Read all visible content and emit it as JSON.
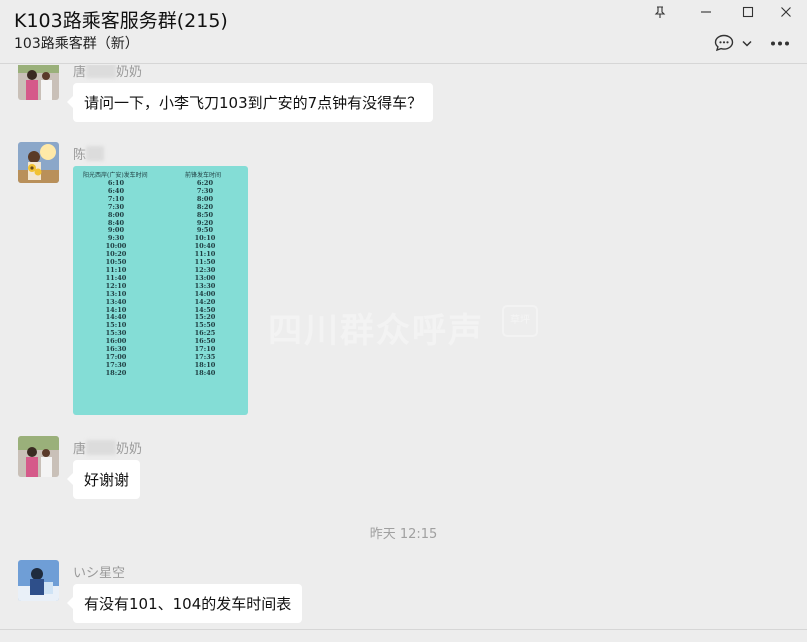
{
  "window": {
    "title": "K103路乘客服务群(215)",
    "subtitle": "103路乘客群（新）"
  },
  "icons": {
    "pin": "pin-icon",
    "minimize": "minimize-icon",
    "maximize": "maximize-icon",
    "close": "close-icon",
    "chat_bubble": "chat-bubble-icon",
    "chevron": "chevron-down-icon",
    "more": "more-icon"
  },
  "messages": [
    {
      "sender_prefix": "唐",
      "sender_suffix": "奶奶",
      "text": "请问一下，小李飞刀103到广安的7点钟有没得车？"
    },
    {
      "sender_prefix": "陈",
      "sender_suffix": "",
      "type": "image"
    },
    {
      "sender_prefix": "唐",
      "sender_suffix": "奶奶",
      "text": "好谢谢"
    },
    {
      "sender_prefix": "いシ星空",
      "sender_suffix": "",
      "text": "有没有101、104的发车时间表"
    }
  ],
  "timestamp": "昨天 12:15",
  "schedule_image": {
    "left_header": "阳光西岸(广安)发车时间",
    "right_header": "前锋发车时间",
    "left_times": [
      "6:10",
      "6:40",
      "7:10",
      "7:30",
      "8:00",
      "8:40",
      "9:00",
      "9:30",
      "10:00",
      "10:20",
      "10:50",
      "11:10",
      "11:40",
      "12:10",
      "13:10",
      "13:40",
      "14:10",
      "14:40",
      "15:10",
      "15:30",
      "16:00",
      "16:30",
      "17:00",
      "17:30",
      "18:20"
    ],
    "right_times": [
      "6:20",
      "7:30",
      "8:00",
      "8:20",
      "8:50",
      "9:20",
      "9:50",
      "10:10",
      "10:40",
      "11:10",
      "11:50",
      "12:30",
      "13:00",
      "13:30",
      "14:00",
      "14:20",
      "14:50",
      "15:20",
      "15:50",
      "16:25",
      "16:50",
      "17:10",
      "17:35",
      "18:10",
      "18:40"
    ],
    "watermark": "四川群众呼声",
    "watermark_badge": "草坪"
  },
  "colors": {
    "background": "#ededed",
    "bubble": "#ffffff",
    "schedule_bg": "#84ddd6"
  }
}
